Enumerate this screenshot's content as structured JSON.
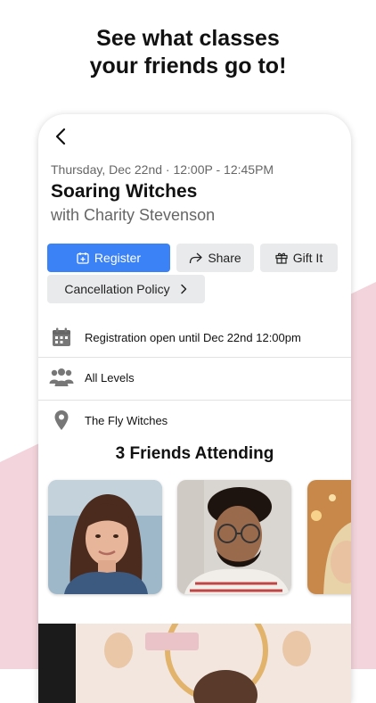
{
  "headline": {
    "line1": "See what classes",
    "line2": "your friends go to!"
  },
  "class_info": {
    "datetime": "Thursday, Dec 22nd · 12:00P - 12:45PM",
    "title": "Soaring Witches",
    "instructor": "with Charity Stevenson"
  },
  "actions": {
    "register": "Register",
    "share": "Share",
    "gift": "Gift It",
    "cancellation": "Cancellation Policy"
  },
  "details": {
    "registration": "Registration open until Dec 22nd 12:00pm",
    "levels": "All Levels",
    "location": "The Fly Witches"
  },
  "friends": {
    "title": "3 Friends Attending"
  },
  "colors": {
    "accent": "#3b82f6",
    "pink": "#f3d4dc",
    "button_bg": "#e9eaec"
  }
}
